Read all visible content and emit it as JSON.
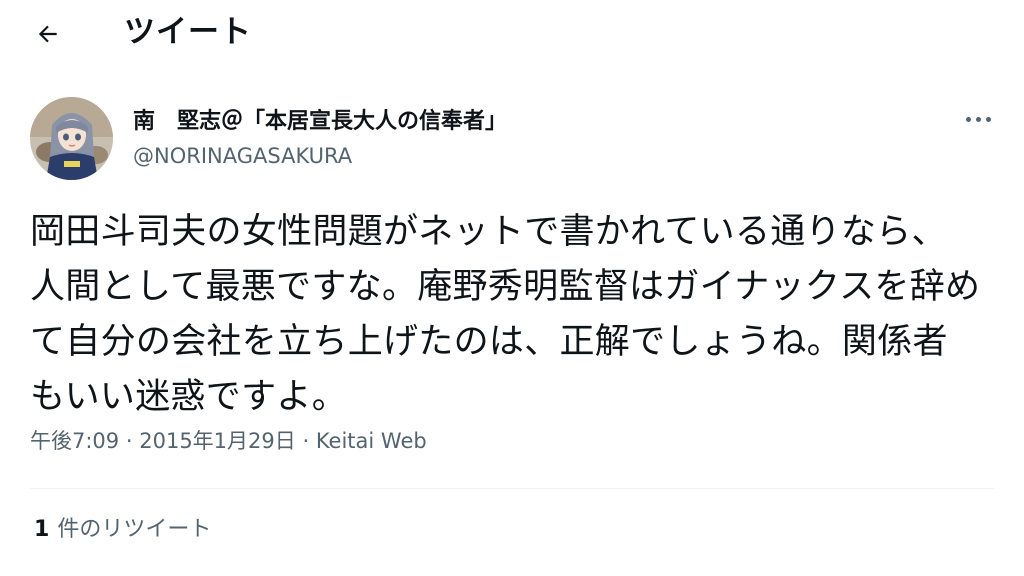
{
  "header": {
    "title": "ツイート",
    "back_icon": "arrow-left-icon"
  },
  "tweet": {
    "author": {
      "display_name": "南　堅志＠「本居宣長大人の信奉者」",
      "handle": "@NORINAGASAKURA",
      "avatar_icon": "anime-character-avatar"
    },
    "more_icon": "more-horizontal-icon",
    "text": "岡田斗司夫の女性問題がネットで書かれている通りなら、人間として最悪ですな。庵野秀明監督はガイナックスを辞めて自分の会社を立ち上げたのは、正解でしょうね。関係者もいい迷惑ですよ。",
    "meta": {
      "time": "午後7:09",
      "separator1": "·",
      "date": "2015年1月29日",
      "separator2": "·",
      "source": "Keitai Web"
    },
    "stats": {
      "retweet_count": "1",
      "retweet_label": "件のリツイート"
    }
  },
  "colors": {
    "text_primary": "#0f1419",
    "text_secondary": "#536471",
    "divider": "#eff3f4",
    "background": "#ffffff"
  }
}
